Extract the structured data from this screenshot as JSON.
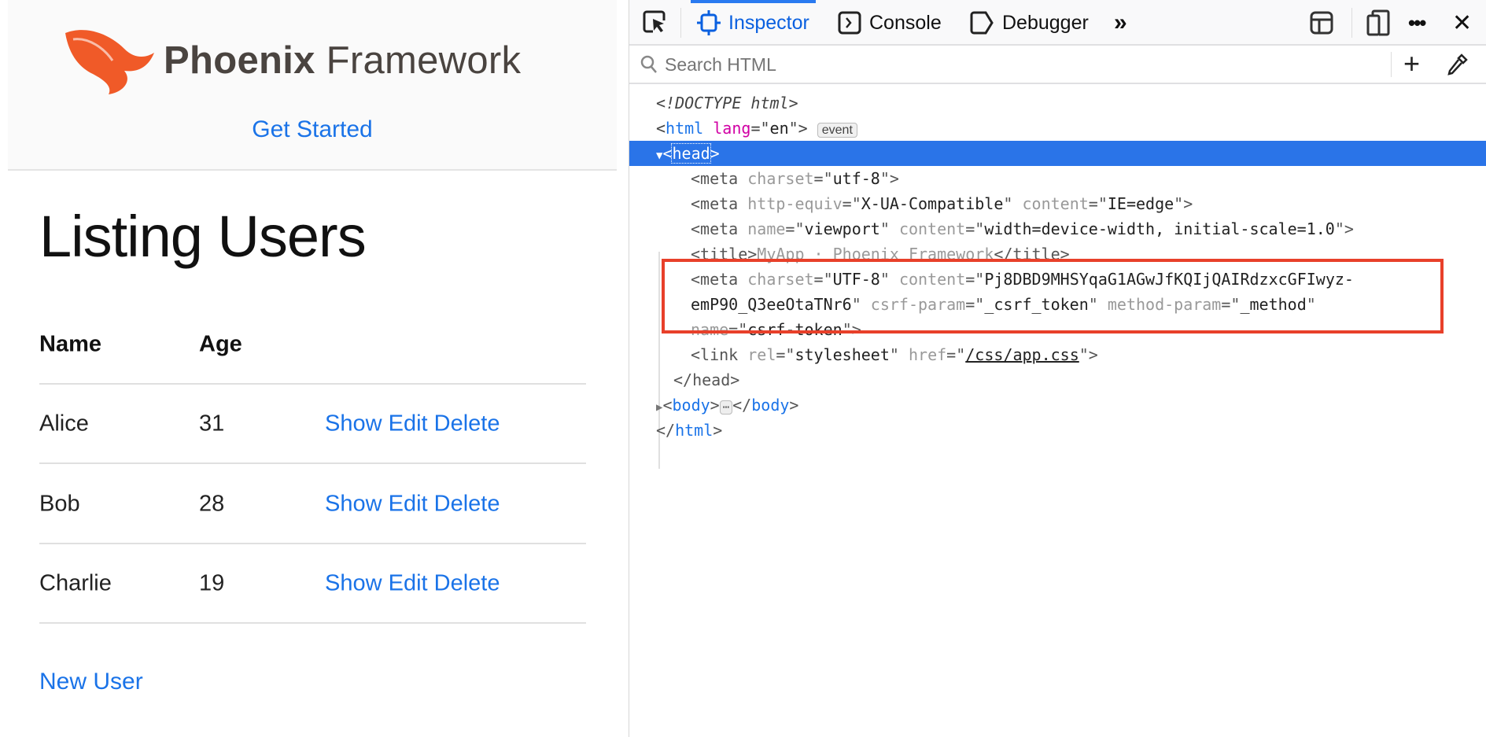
{
  "page": {
    "brand": {
      "bold": "Phoenix",
      "rest": " Framework"
    },
    "get_started": "Get Started",
    "title": "Listing Users",
    "table": {
      "headers": [
        "Name",
        "Age"
      ],
      "rows": [
        {
          "name": "Alice",
          "age": "31",
          "actions": "Show Edit Delete"
        },
        {
          "name": "Bob",
          "age": "28",
          "actions": "Show Edit Delete"
        },
        {
          "name": "Charlie",
          "age": "19",
          "actions": "Show Edit Delete"
        }
      ]
    },
    "new_user": "New User"
  },
  "devtools": {
    "tabs": [
      {
        "label": "Inspector",
        "selected": true
      },
      {
        "label": "Console"
      },
      {
        "label": "Debugger"
      }
    ],
    "search_placeholder": "Search HTML",
    "accent": "#2a74e8",
    "highlight_box_color": "#e8402a",
    "lines": {
      "doctype": "<!DOCTYPE html>",
      "html_open": {
        "tag": "html",
        "attr": "lang",
        "val": "en",
        "badge": "event"
      },
      "head": "head",
      "meta1": {
        "attr": "charset",
        "val": "utf-8"
      },
      "meta2": {
        "a1": "http-equiv",
        "v1": "X-UA-Compatible",
        "a2": "content",
        "v2": "IE=edge"
      },
      "meta3": {
        "a1": "name",
        "v1": "viewport",
        "a2": "content",
        "v2": "width=device-width, initial-scale=1.0"
      },
      "title": "MyApp · Phoenix Framework",
      "meta4": {
        "a1": "charset",
        "v1": "UTF-8",
        "a2": "content",
        "v2a": "Pj8DBD9MHSYqaG1AGwJfKQIjQAIRdzxcGFIwyz-",
        "v2b": "emP90_Q3eeOtaTNr6",
        "a3": "csrf-param",
        "v3": "_csrf_token",
        "a4": "method-param",
        "v4": "_method",
        "a5": "name",
        "v5": "csrf-token"
      },
      "link": {
        "a1": "rel",
        "v1": "stylesheet",
        "a2": "href",
        "v2": "/css/app.css"
      },
      "head_close": "</head>",
      "body": "body",
      "html_close": "html"
    }
  }
}
